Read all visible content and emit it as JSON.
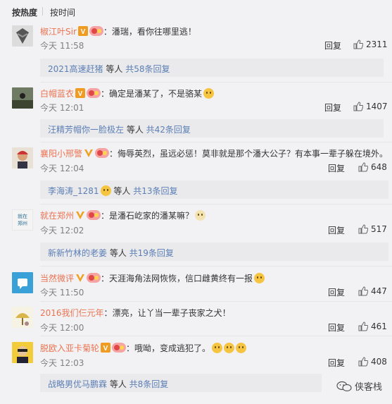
{
  "sort": {
    "hot": "按热度",
    "time": "按时间"
  },
  "comments": [
    {
      "user": "椒江叶Sir",
      "text": "潘瑞，看你往哪里逃！",
      "time": "今天 11:58",
      "reply": "回复",
      "likes": "2311",
      "sub": {
        "name": "2021高速赶猪",
        "mid": " 等人 ",
        "count": "共58条回复"
      }
    },
    {
      "user": "白帽蓝衣",
      "text": "确定是潘某了，不是骆某",
      "time": "今天 12:01",
      "reply": "回复",
      "likes": "1407",
      "sub": {
        "name": "汪精芳帽你一脸极左",
        "mid": " 等人 ",
        "count": "共42条回复"
      }
    },
    {
      "user": "襄阳小邢警",
      "text": "侮辱英烈，虽远必惩！莫非就是那个潘大公子？有本事一辈子躲在境外。",
      "time": "今天 12:04",
      "reply": "回复",
      "likes": "648",
      "sub": {
        "name": "李海涛_1281",
        "mid": " 等人 ",
        "count": "共13条回复"
      }
    },
    {
      "user": "就在郑州",
      "text": "是潘石屹家的潘某嘛？",
      "time": "今天 12:02",
      "reply": "回复",
      "likes": "517",
      "sub": {
        "name": "新新竹林的老姜",
        "mid": " 等人 ",
        "count": "共19条回复"
      }
    },
    {
      "user": "当然微评",
      "text": "天涯海角法网恢恢，信口雌黄终有一报",
      "time": "今天 11:50",
      "reply": "回复",
      "likes": "447"
    },
    {
      "user": "2016我们仨元年",
      "text": "漂亮，让丫当一辈子丧家之犬！",
      "time": "今天 12:00",
      "reply": "回复",
      "likes": "461"
    },
    {
      "user": "脱欧入亚卡菊轮",
      "text": "哦呦，变成逃犯了。",
      "time": "今天 12:03",
      "reply": "回复",
      "likes": "408",
      "sub": {
        "name": "战略男优马鹏霖",
        "mid": " 等人 ",
        "count": "共8条回复"
      }
    }
  ],
  "watermark": "侠客栈"
}
